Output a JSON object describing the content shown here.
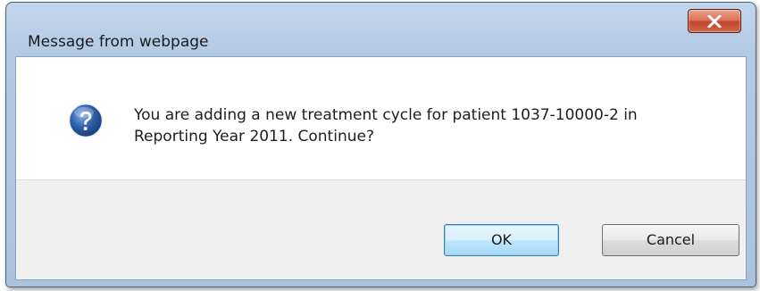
{
  "dialog": {
    "title": "Message from webpage",
    "close_icon": "close-x-icon",
    "message_icon": "question-icon",
    "message_line1": "You are adding a new treatment cycle for patient 1037-10000-2 in",
    "message_line2": "Reporting Year 2011. Continue?",
    "buttons": {
      "ok_label": "OK",
      "cancel_label": "Cancel"
    }
  },
  "colors": {
    "frame": "#b3cae4",
    "close_button": "#c3462a",
    "question_icon": "#2f5fa8",
    "ok_border": "#3c7fb1"
  }
}
